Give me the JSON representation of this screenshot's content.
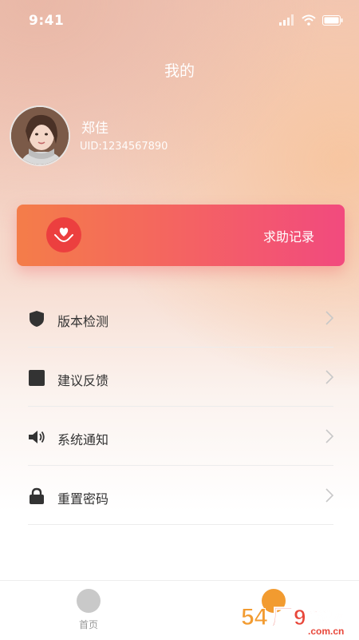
{
  "status_bar": {
    "time": "9:41"
  },
  "header": {
    "title": "我的"
  },
  "profile": {
    "name": "郑佳",
    "uid": "UID:1234567890"
  },
  "help_card": {
    "label": "求助记录",
    "icon": "heart-in-hands-icon"
  },
  "menu": {
    "items": [
      {
        "label": "版本检测",
        "icon": "shield-icon"
      },
      {
        "label": "建议反馈",
        "icon": "square-icon"
      },
      {
        "label": "系统通知",
        "icon": "speaker-icon"
      },
      {
        "label": "重置密码",
        "icon": "lock-icon"
      }
    ]
  },
  "tabbar": {
    "tabs": [
      {
        "label": "首页",
        "icon": "home-icon"
      },
      {
        "label": "",
        "icon": "profile-icon"
      }
    ]
  },
  "watermark": {
    "text": "54厂9手游网",
    "sub": ".com.cn"
  },
  "colors": {
    "card_start": "#f47d49",
    "card_end": "#f24a7e",
    "tab_active": "#f29b30",
    "tab_inactive": "#c9c9c9"
  }
}
